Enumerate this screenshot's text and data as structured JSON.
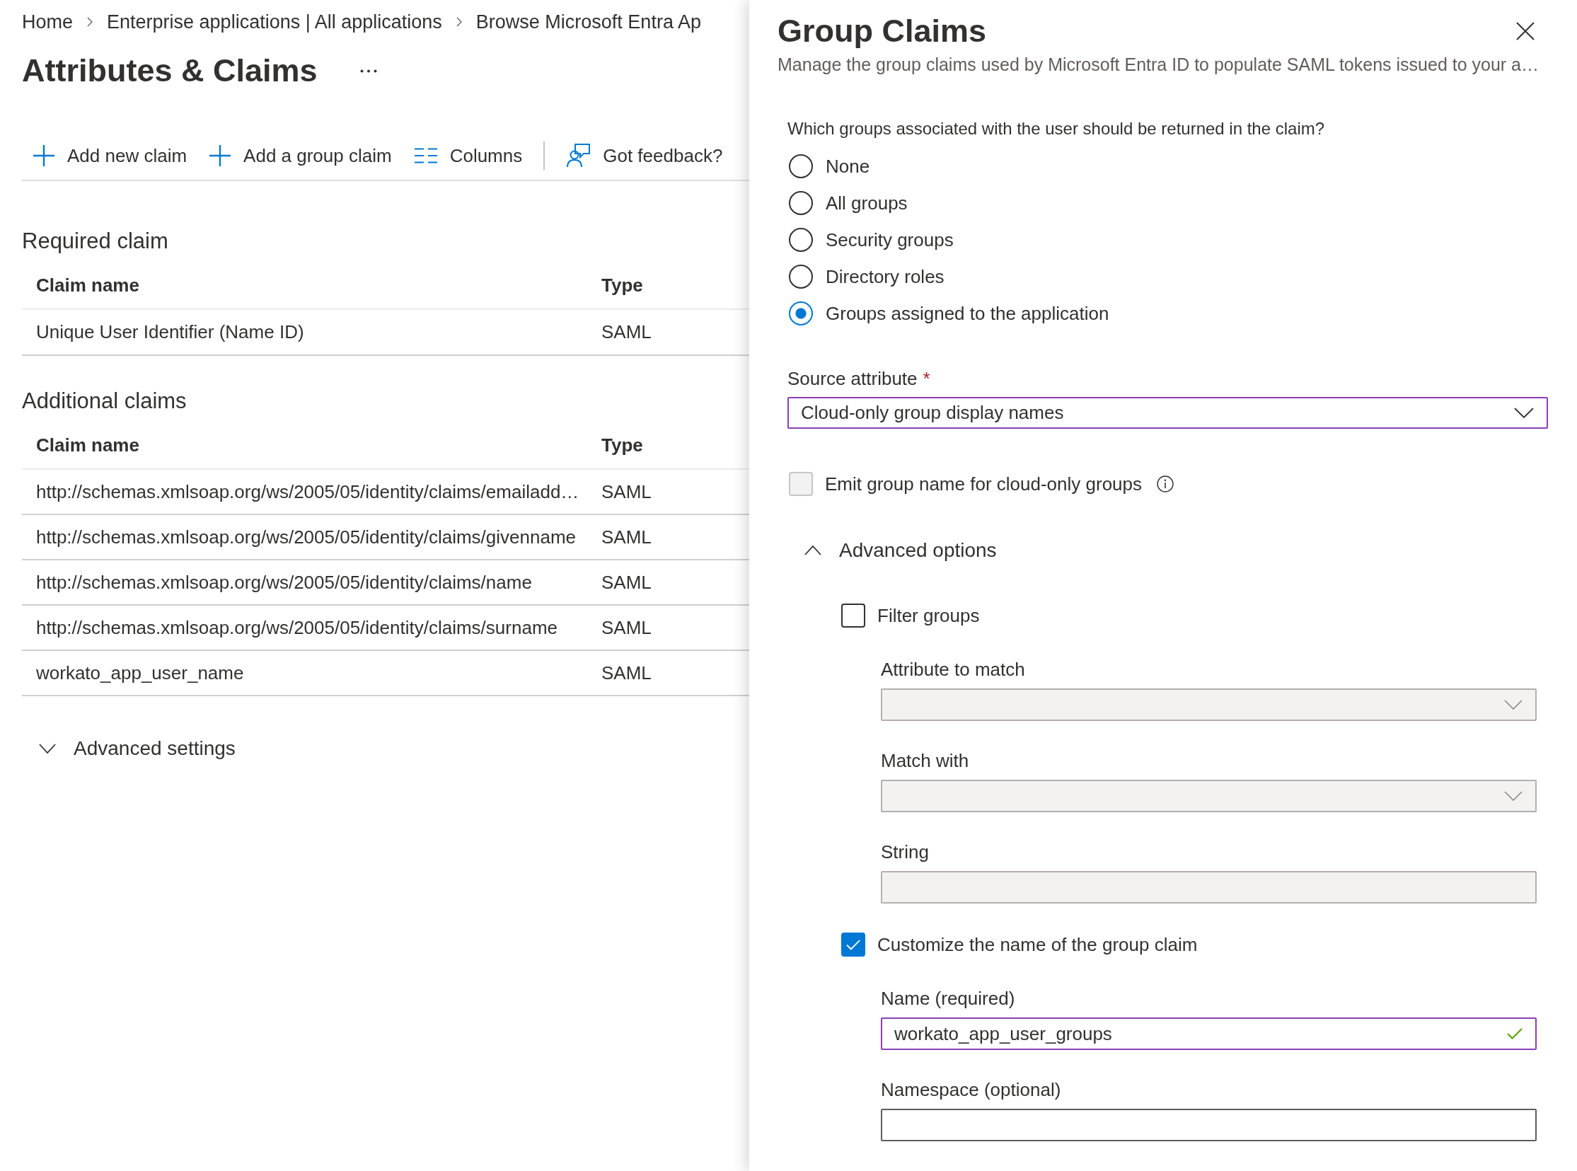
{
  "breadcrumb": [
    {
      "label": "Home"
    },
    {
      "label": "Enterprise applications | All applications"
    },
    {
      "label": "Browse Microsoft Entra Ap"
    }
  ],
  "page": {
    "title": "Attributes & Claims"
  },
  "toolbar": [
    {
      "kind": "add",
      "label": "Add new claim"
    },
    {
      "kind": "add",
      "label": "Add a group claim"
    },
    {
      "kind": "columns",
      "label": "Columns"
    },
    {
      "kind": "feedback",
      "label": "Got feedback?"
    }
  ],
  "required_claim": {
    "heading": "Required claim",
    "columns": [
      "Claim name",
      "Type"
    ],
    "rows": [
      [
        "Unique User Identifier (Name ID)",
        "SAML"
      ]
    ]
  },
  "additional_claims": {
    "heading": "Additional claims",
    "columns": [
      "Claim name",
      "Type"
    ],
    "rows": [
      [
        "http://schemas.xmlsoap.org/ws/2005/05/identity/claims/emailadd…",
        "SAML"
      ],
      [
        "http://schemas.xmlsoap.org/ws/2005/05/identity/claims/givenname",
        "SAML"
      ],
      [
        "http://schemas.xmlsoap.org/ws/2005/05/identity/claims/name",
        "SAML"
      ],
      [
        "http://schemas.xmlsoap.org/ws/2005/05/identity/claims/surname",
        "SAML"
      ],
      [
        "workato_app_user_name",
        "SAML"
      ]
    ]
  },
  "advanced_settings": {
    "label": "Advanced settings",
    "expanded": false
  },
  "panel": {
    "title": "Group Claims",
    "subtitle": "Manage the group claims used by Microsoft Entra ID to populate SAML tokens issued to your a…",
    "question": "Which groups associated with the user should be returned in the claim?",
    "options": [
      {
        "label": "None",
        "selected": false
      },
      {
        "label": "All groups",
        "selected": false
      },
      {
        "label": "Security groups",
        "selected": false
      },
      {
        "label": "Directory roles",
        "selected": false
      },
      {
        "label": "Groups assigned to the application",
        "selected": true
      }
    ],
    "source_attribute": {
      "label": "Source attribute",
      "required_mark": "*",
      "value": "Cloud-only group display names",
      "modified": true
    },
    "emit_group_name": {
      "label": "Emit group name for cloud-only groups",
      "checked": false,
      "disabled": true
    },
    "advanced_options": {
      "label": "Advanced options",
      "expanded": true,
      "items": [
        {
          "kind": "checkbox",
          "label": "Filter groups",
          "checked": false
        },
        {
          "kind": "dropdown",
          "label": "Attribute to match",
          "disabled": true,
          "modified": false
        },
        {
          "kind": "dropdown",
          "label": "Match with",
          "disabled": true,
          "modified": false
        },
        {
          "kind": "text",
          "label": "String",
          "disabled": true,
          "modified": false,
          "valid": false
        },
        {
          "kind": "checkbox",
          "label": "Customize the name of the group claim",
          "checked": true
        },
        {
          "kind": "text",
          "label": "Name (required)",
          "value": "workato_app_user_groups",
          "disabled": false,
          "modified": true,
          "valid": true
        },
        {
          "kind": "text",
          "label": "Namespace (optional)",
          "disabled": false,
          "modified": false,
          "valid": false
        }
      ]
    }
  }
}
